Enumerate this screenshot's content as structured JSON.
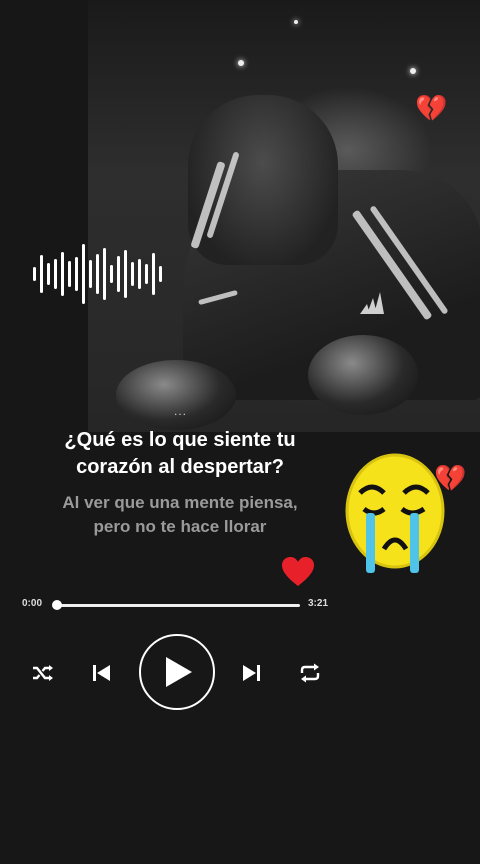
{
  "player": {
    "lyrics": {
      "current": [
        "¿Qué es lo que siente tu",
        "corazón al despertar?"
      ],
      "next": [
        "Al ver que una mente piensa,",
        "pero no te hace llorar"
      ]
    },
    "progress": {
      "elapsed": "0:00",
      "total": "3:21",
      "fraction": 0.0
    },
    "controls": {
      "shuffle_icon": "shuffle-icon",
      "previous_icon": "skip-previous-icon",
      "play_icon": "play-icon",
      "next_icon": "skip-next-icon",
      "repeat_icon": "repeat-icon"
    },
    "like_icon": "heart-icon",
    "more_indicator": "..."
  },
  "decorations": {
    "broken_heart": "💔",
    "sad_face": "crying-face-emoji",
    "waveform": "audio-waveform"
  },
  "colors": {
    "background": "#171717",
    "accent_red": "#e8202a",
    "lyric_next": "#9a9a9a"
  }
}
